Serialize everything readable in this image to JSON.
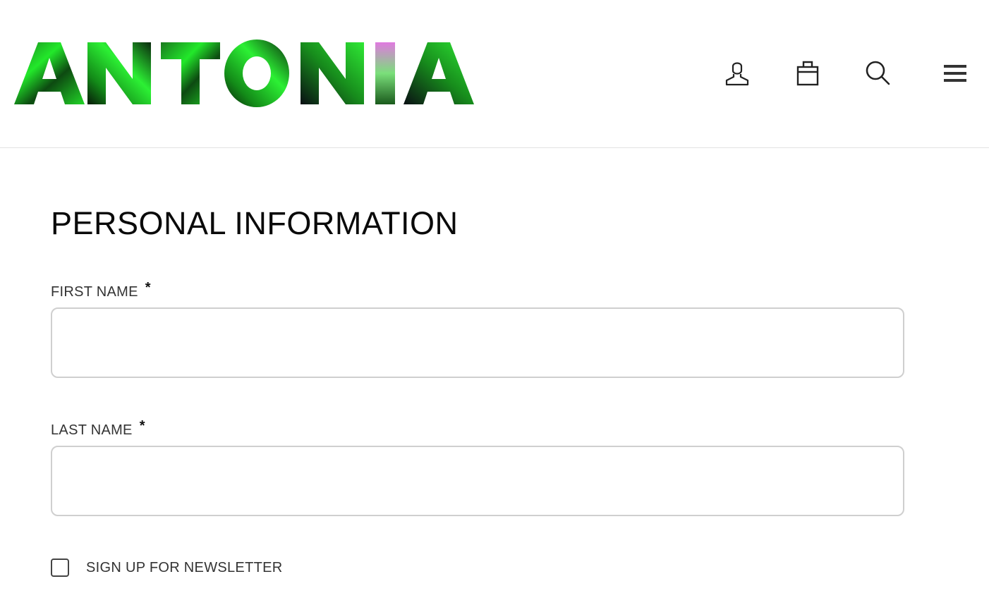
{
  "header": {
    "logo_text": "ANTONIA",
    "icons": {
      "account": "user-icon",
      "bag": "shopping-bag-icon",
      "search": "search-icon",
      "menu": "hamburger-menu-icon"
    }
  },
  "form": {
    "title": "PERSONAL INFORMATION",
    "first_name": {
      "label": "FIRST NAME",
      "required_mark": "*",
      "value": ""
    },
    "last_name": {
      "label": "LAST NAME",
      "required_mark": "*",
      "value": ""
    },
    "newsletter": {
      "label": "SIGN UP FOR NEWSLETTER",
      "checked": false
    }
  },
  "colors": {
    "logo_green": "#22e82a",
    "logo_dark": "#0b2a0e",
    "logo_pink": "#e07ae0",
    "input_border": "#cfcfcf",
    "divider": "#e2e2e2"
  }
}
